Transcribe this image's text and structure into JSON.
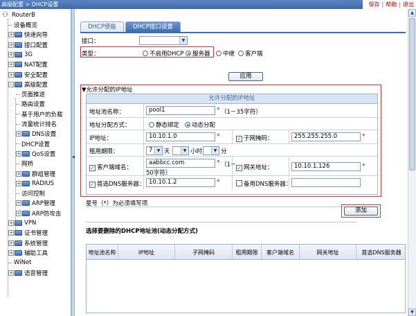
{
  "topbar": {
    "breadcrumb": "高级配置 > DHCP设置",
    "links": [
      "保存",
      "帮助",
      "退出"
    ]
  },
  "sidebar": {
    "root": "RouterB",
    "items": [
      {
        "label": "设备概览",
        "level": 1,
        "type": "leaf"
      },
      {
        "label": "快速向导",
        "level": 1,
        "type": "folder"
      },
      {
        "label": "接口配置",
        "level": 1,
        "type": "folder"
      },
      {
        "label": "3G",
        "level": 1,
        "type": "folder"
      },
      {
        "label": "NAT配置",
        "level": 1,
        "type": "folder"
      },
      {
        "label": "安全配置",
        "level": 1,
        "type": "folder"
      },
      {
        "label": "高级配置",
        "level": 1,
        "type": "folder-open"
      },
      {
        "label": "页面推送",
        "level": 2,
        "type": "leaf"
      },
      {
        "label": "路由设置",
        "level": 2,
        "type": "leaf"
      },
      {
        "label": "基于用户的负载",
        "level": 2,
        "type": "leaf"
      },
      {
        "label": "流量统计排名",
        "level": 2,
        "type": "leaf"
      },
      {
        "label": "DNS设置",
        "level": 2,
        "type": "folder"
      },
      {
        "label": "DHCP设置",
        "level": 2,
        "type": "leaf"
      },
      {
        "label": "QoS设置",
        "level": 2,
        "type": "folder"
      },
      {
        "label": "网桥",
        "level": 2,
        "type": "leaf"
      },
      {
        "label": "群组管理",
        "level": 2,
        "type": "folder"
      },
      {
        "label": "RADIUS",
        "level": 2,
        "type": "folder"
      },
      {
        "label": "访问控制",
        "level": 2,
        "type": "leaf"
      },
      {
        "label": "ARP管理",
        "level": 2,
        "type": "folder"
      },
      {
        "label": "ARP防攻击",
        "level": 2,
        "type": "folder"
      },
      {
        "label": "VPN",
        "level": 1,
        "type": "folder"
      },
      {
        "label": "证书管理",
        "level": 1,
        "type": "folder"
      },
      {
        "label": "系统管理",
        "level": 1,
        "type": "folder"
      },
      {
        "label": "辅助工具",
        "level": 1,
        "type": "folder"
      },
      {
        "label": "WiNet",
        "level": 1,
        "type": "leaf"
      },
      {
        "label": "语音管理",
        "level": 1,
        "type": "folder"
      }
    ]
  },
  "tabs": {
    "dhcp_enable": "DHCP使能",
    "dhcp_interface": "DHCP接口设置"
  },
  "form": {
    "interface_label": "接口：",
    "interface_value": "",
    "type_label": "类型：",
    "type_options": [
      "不启用DHCP",
      "服务器",
      "中继",
      "客户端"
    ],
    "type_selected": "服务器",
    "apply_button": "应用",
    "section_label": "▼允许分配的IP地址",
    "box_title": "允许分配的IP地址",
    "pool_name_label": "地址池名称：",
    "pool_name_value": "pool1",
    "pool_name_hint": "（1－35字符）",
    "alloc_mode_label": "地址分配方式：",
    "alloc_modes": [
      "静态绑定",
      "动态分配"
    ],
    "alloc_selected": "动态分配",
    "ip_label": "IP地址：",
    "ip_value": "10.10.1.0",
    "mask_label": "子网掩码：",
    "mask_value": "255.255.255.0",
    "lease_label": "租用期限：",
    "lease_days": "7",
    "lease_day_unit": "天",
    "lease_hours": "",
    "lease_hour_unit": "小时",
    "lease_minutes": "",
    "lease_minute_unit": "分",
    "domain_label": "客户端域名：",
    "domain_value": "aabbcc.com",
    "domain_hint_1": "（1－",
    "domain_hint_2": "50字符）",
    "gateway_label": "网关地址：",
    "gateway_value": "10.10.1.126",
    "dns1_label": "首选DNS服务器：",
    "dns1_value": "10.10.1.2",
    "dns2_label": "备用DNS服务器：",
    "dns2_value": "",
    "required_note": "星号（*）为必须填写项",
    "add_button": "添加",
    "delete_title": "选择要删除的DHCP地址池(动态分配方式)"
  },
  "table": {
    "headers": [
      "地址池名称",
      "IP地址",
      "子网掩码",
      "租用期限",
      "客户端域名",
      "网关地址",
      "首选DNS服务器"
    ]
  }
}
